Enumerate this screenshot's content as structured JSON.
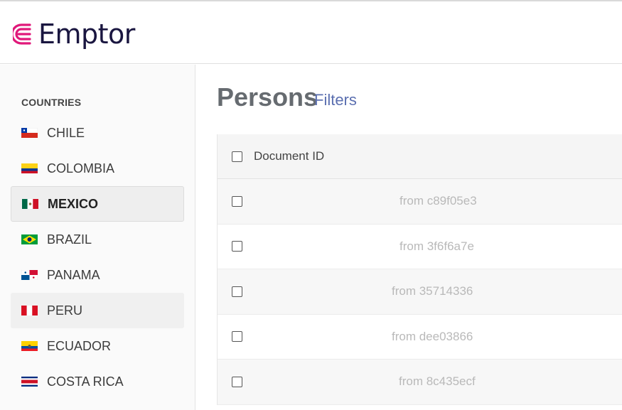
{
  "app": {
    "logo_text": "Emptor"
  },
  "sidebar": {
    "heading": "COUNTRIES",
    "items": [
      {
        "label": "CHILE",
        "flag": "chile-flag-icon"
      },
      {
        "label": "COLOMBIA",
        "flag": "colombia-flag-icon"
      },
      {
        "label": "MEXICO",
        "flag": "mexico-flag-icon",
        "selected": true
      },
      {
        "label": "BRAZIL",
        "flag": "brazil-flag-icon"
      },
      {
        "label": "PANAMA",
        "flag": "panama-flag-icon"
      },
      {
        "label": "PERU",
        "flag": "peru-flag-icon",
        "hovered": true
      },
      {
        "label": "ECUADOR",
        "flag": "ecuador-flag-icon"
      },
      {
        "label": "COSTA RICA",
        "flag": "costa-rica-flag-icon"
      }
    ]
  },
  "main": {
    "title": "Persons",
    "filters_label": "Filters",
    "table": {
      "header": "Document ID",
      "rows": [
        "from c89f05e3",
        "from 3f6f6a7e",
        "from 35714336",
        "from dee03866",
        "from 8c435ecf"
      ]
    }
  },
  "colors": {
    "brand_text": "#1a1640",
    "brand_accent": "#e0187a",
    "link": "#5b6fb0"
  }
}
